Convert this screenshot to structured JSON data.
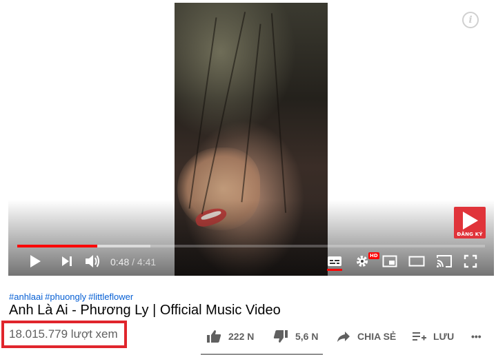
{
  "player": {
    "info_icon": "i",
    "watermark_label": "ĐĂNG KÝ",
    "current_time": "0:48",
    "separator": " / ",
    "duration": "4:41",
    "progress_fraction": 0.171,
    "buffer_fraction": 0.285,
    "hd_badge": "HD",
    "controls": [
      "play-icon",
      "next-icon",
      "volume-icon",
      "subtitles-icon",
      "settings-icon",
      "miniplayer-icon",
      "theater-icon",
      "cast-icon",
      "fullscreen-icon"
    ]
  },
  "video": {
    "hashtags": [
      "#anhlaai",
      "#phuongly",
      "#littleflower"
    ],
    "title": "Anh Là Ai - Phương Ly | Official Music Video",
    "views": "18.015.779 lượt xem"
  },
  "actions": {
    "like_count": "222 N",
    "dislike_count": "5,6 N",
    "share_label": "CHIA SẺ",
    "save_label": "LƯU",
    "more_label": "•••"
  },
  "colors": {
    "progress": "#ff0000",
    "link": "#065fd4",
    "highlight_box": "#e0252c",
    "watermark": "#e0343a"
  }
}
